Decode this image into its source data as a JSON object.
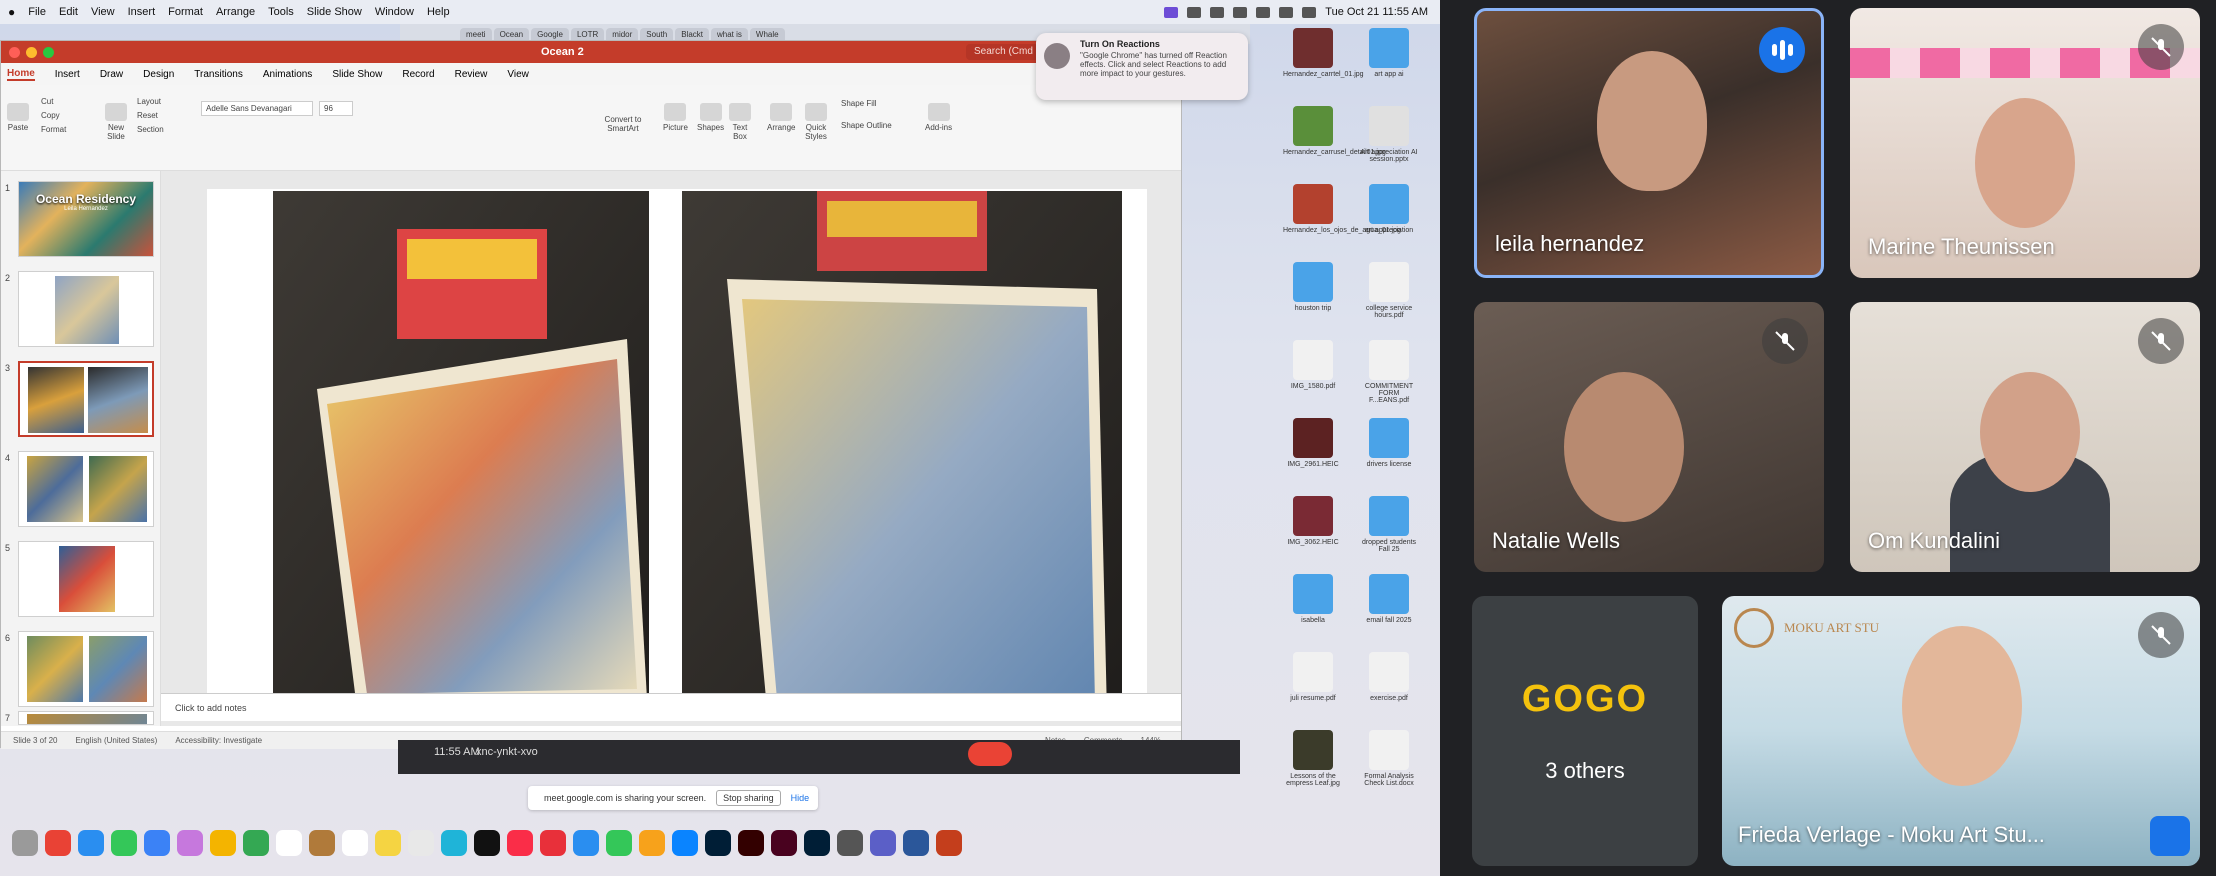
{
  "mac_menubar": {
    "items": [
      "File",
      "Edit",
      "View",
      "Insert",
      "Format",
      "Arrange",
      "Tools",
      "Slide Show",
      "Window",
      "Help"
    ],
    "clock": "Tue Oct 21  11:55 AM"
  },
  "chrome_tabs": [
    "meeti",
    "Ocean",
    "Google",
    "LOTR",
    "midor",
    "South",
    "Blackt",
    "what is",
    "Whale"
  ],
  "notification": {
    "title": "Turn On Reactions",
    "body": "\"Google Chrome\" has turned off Reaction effects. Click and select Reactions to add more impact to your gestures."
  },
  "powerpoint": {
    "file_name": "Ocean 2",
    "search": "Search (Cmd",
    "tabs": [
      "Home",
      "Insert",
      "Draw",
      "Design",
      "Transitions",
      "Animations",
      "Slide Show",
      "Record",
      "Review",
      "View"
    ],
    "ribbon": {
      "paste": "Paste",
      "cut": "Cut",
      "copy": "Copy",
      "format": "Format",
      "new_slide": "New Slide",
      "layout": "Layout",
      "reset": "Reset",
      "section": "Section",
      "font": "Adelle Sans Devanagari",
      "size": "96",
      "convert": "Convert to SmartArt",
      "picture": "Picture",
      "shapes": "Shapes",
      "textbox": "Text Box",
      "arrange": "Arrange",
      "quick": "Quick Styles",
      "shape_fill": "Shape Fill",
      "shape_outline": "Shape Outline",
      "addins": "Add-ins"
    },
    "slide_count": [
      "1",
      "2",
      "3",
      "4",
      "5",
      "6",
      "7"
    ],
    "slide1_title": "Ocean Residency",
    "slide1_sub": "Leila Hernandez",
    "notes": "Click to add notes",
    "status": {
      "slide": "Slide 3 of 20",
      "lang": "English (United States)",
      "access": "Accessibility: Investigate",
      "notes": "Notes",
      "comments": "Comments",
      "zoom": "144%"
    }
  },
  "meet_strip": {
    "time": "11:55 AM",
    "code": "xnc-ynkt-xvo"
  },
  "share_bar": {
    "text": "meet.google.com is sharing your screen.",
    "stop": "Stop sharing",
    "hide": "Hide"
  },
  "desktop_files": [
    "Hernandez_carrtel_01.jpg",
    "art app ai",
    "Hernandez_carrusel_detail01.jpg",
    "Art appreciation AI session.pptx",
    "Hernandez_los_ojos_de_agua_01.jpg",
    "art appreciation",
    "houston trip",
    "college service hours.pdf",
    "IMG_1580.pdf",
    "COMMITMENT FORM F...EANS.pdf",
    "IMG_2961.HEIC",
    "drivers license",
    "IMG_3062.HEIC",
    "dropped students Fall 25",
    "isabella",
    "email fall 2025",
    "juli resume.pdf",
    "exercise.pdf",
    "Lessons of the empress Leaf.jpg",
    "Formal Analysis Check List.docx"
  ],
  "participants": [
    {
      "name": "leila hernandez",
      "state": "speaking"
    },
    {
      "name": "Marine Theunissen",
      "state": "muted"
    },
    {
      "name": "Natalie Wells",
      "state": "muted"
    },
    {
      "name": "Om Kundalini",
      "state": "muted"
    },
    {
      "name": "Frieda Verlage - Moku Art Stu...",
      "state": "muted"
    }
  ],
  "others": {
    "label": "3 others",
    "logo": "GOGO"
  },
  "moku_sign": "MOKU ART STU"
}
